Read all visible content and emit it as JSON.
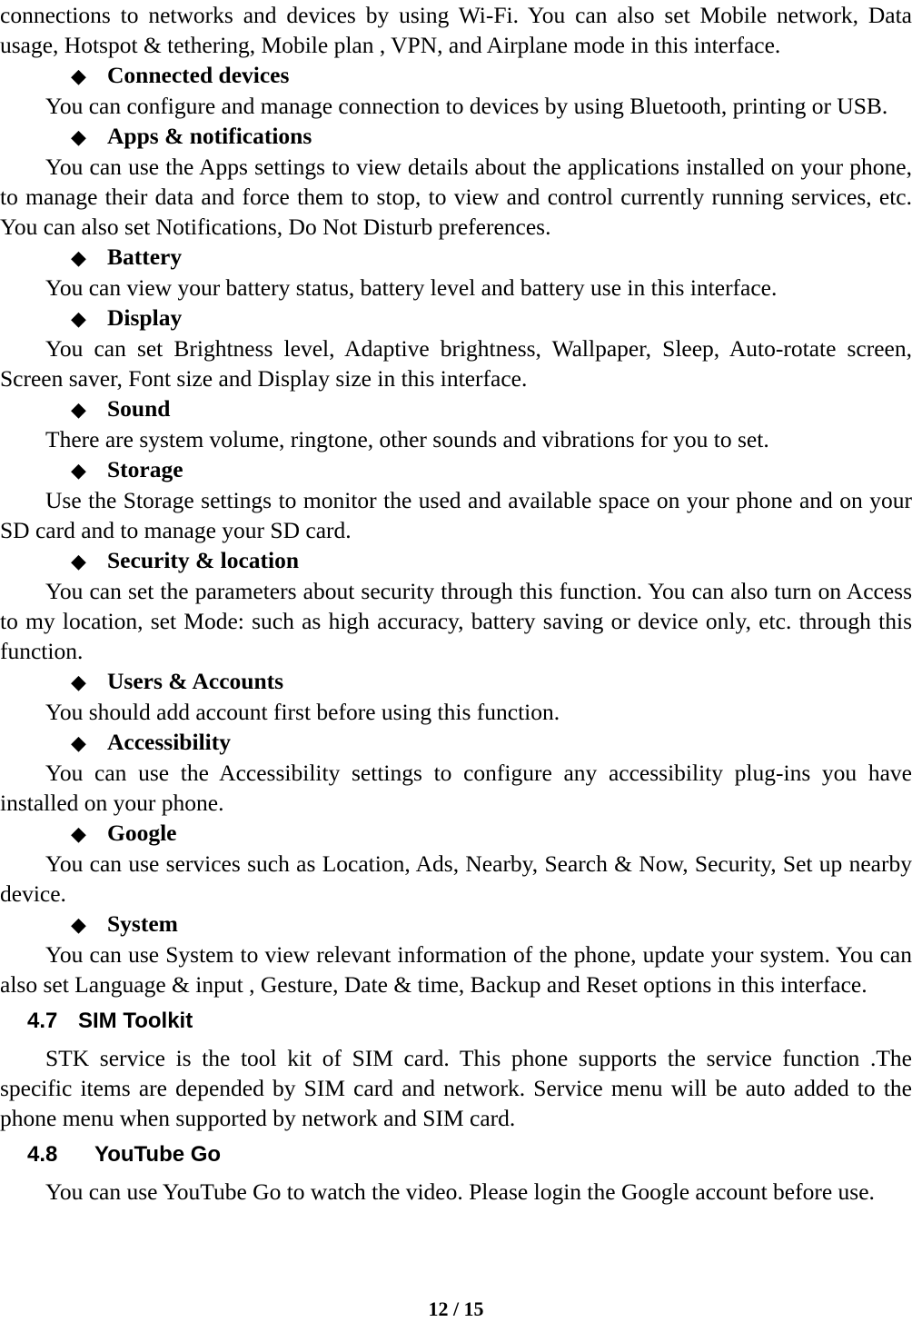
{
  "document": {
    "page_footer": "12 / 15",
    "bullet_glyph": "◆"
  },
  "blocks": {
    "intro_paragraph": "connections to networks and devices by using Wi-Fi. You can also set Mobile network, Data usage, Hotspot & tethering, Mobile plan , VPN, and Airplane mode in this interface.",
    "connected_devices_heading": "Connected devices",
    "connected_devices_body": "You can configure and manage connection to devices by using Bluetooth, printing or USB.",
    "apps_notifications_heading": "Apps & notifications",
    "apps_notifications_body": "You can use the Apps settings to view details about the applications installed on your phone, to manage their data and force them to stop, to view and control currently running services, etc. You can also set Notifications, Do Not Disturb preferences.",
    "battery_heading": "Battery",
    "battery_body": "You can view your battery status, battery level and battery use in this interface.",
    "display_heading": "Display",
    "display_body": "You can set Brightness level, Adaptive brightness, Wallpaper, Sleep, Auto-rotate screen, Screen saver, Font size and Display size in this interface.",
    "sound_heading": "Sound",
    "sound_body": "There are system volume, ringtone, other sounds and vibrations for you to set.",
    "storage_heading": "Storage",
    "storage_body": "Use the Storage settings to monitor the used and available space on your phone and on your SD card and to manage your SD card.",
    "security_location_heading": "Security & location",
    "security_location_body": "You can set the parameters about security through this function. You can also turn on Access to my location, set Mode: such as high accuracy, battery saving or device only, etc. through this function.",
    "users_accounts_heading": "Users & Accounts",
    "users_accounts_body": "You should add account first before using this function.",
    "accessibility_heading": "Accessibility",
    "accessibility_body": "You can use the Accessibility settings to configure any accessibility plug-ins you have installed on your phone.",
    "google_heading": "Google",
    "google_body": "You can use services such as Location, Ads, Nearby, Search & Now, Security, Set up nearby device.",
    "system_heading": "System",
    "system_body": "You can use System to view relevant information of the phone, update your system. You can also set Language & input , Gesture, Date & time, Backup and Reset options in this interface.",
    "section_4_7_number": "4.7",
    "section_4_7_title": "SIM Toolkit",
    "section_4_7_body": "STK service is the tool kit of SIM card. This phone supports the service function .The specific items are depended by SIM card and network. Service menu will be auto added to the phone menu when supported by network and SIM card.",
    "section_4_8_number": "4.8",
    "section_4_8_title": "YouTube Go",
    "section_4_8_body": "You can use YouTube Go to watch the video. Please login the Google account before use."
  }
}
